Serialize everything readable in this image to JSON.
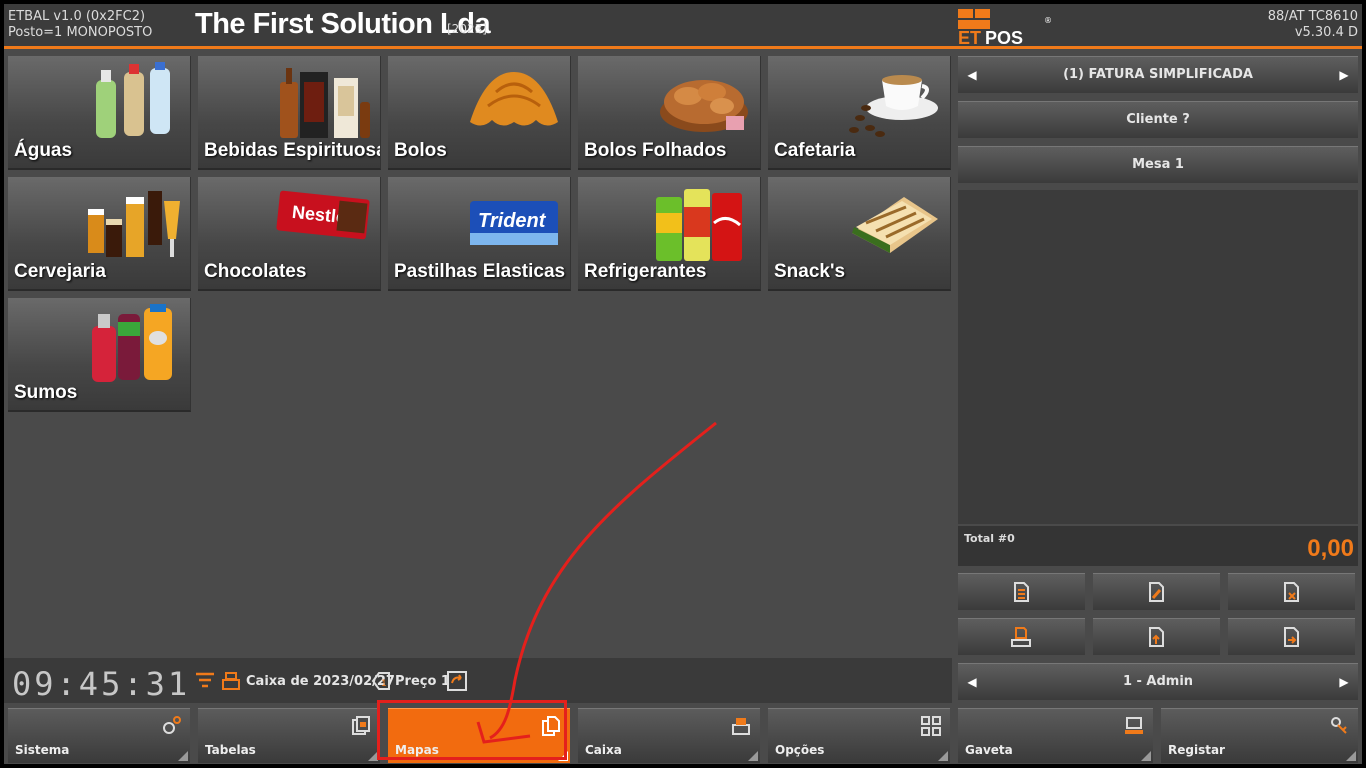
{
  "header": {
    "app_version": "ETBAL v1.0 (0x2FC2)",
    "station": "Posto=1 MONOPOSTO",
    "company": "The First Solution Lda",
    "year": "[2023]",
    "logo_text": "ETPOS",
    "logo_mark": "®",
    "terminal": "88/AT TC8610",
    "version": "v5.30.4 D"
  },
  "categories": [
    {
      "label": "Águas",
      "icon": "water-bottles"
    },
    {
      "label": "Bebidas Espirituosas",
      "icon": "liquor-bottles"
    },
    {
      "label": "Bolos",
      "icon": "croissant"
    },
    {
      "label": "Bolos Folhados",
      "icon": "pastry-basket"
    },
    {
      "label": "Cafetaria",
      "icon": "coffee-cup"
    },
    {
      "label": "Cervejaria",
      "icon": "beer-glasses"
    },
    {
      "label": "Chocolates",
      "icon": "chocolate-bar"
    },
    {
      "label": "Pastilhas Elasticas",
      "icon": "gum-pack"
    },
    {
      "label": "Refrigerantes",
      "icon": "soda-cans"
    },
    {
      "label": "Snack's",
      "icon": "sandwich"
    },
    {
      "label": "Sumos",
      "icon": "juice-bottles"
    }
  ],
  "status": {
    "clock": "09:45:31",
    "cash_register": "Caixa de 2023/02/27",
    "price": "Preço 1"
  },
  "bottom_buttons": {
    "sistema": "Sistema",
    "tabelas": "Tabelas",
    "mapas": "Mapas",
    "caixa": "Caixa",
    "opcoes": "Opções",
    "gaveta": "Gaveta",
    "registar": "Registar"
  },
  "panel": {
    "doc_type": "(1) FATURA SIMPLIFICADA",
    "client": "Cliente ?",
    "table": "Mesa 1",
    "total_label": "Total #0",
    "total_value": "0,00",
    "operator": "1 - Admin"
  },
  "colors": {
    "accent": "#f07a1a",
    "highlight": "#e4201c"
  }
}
